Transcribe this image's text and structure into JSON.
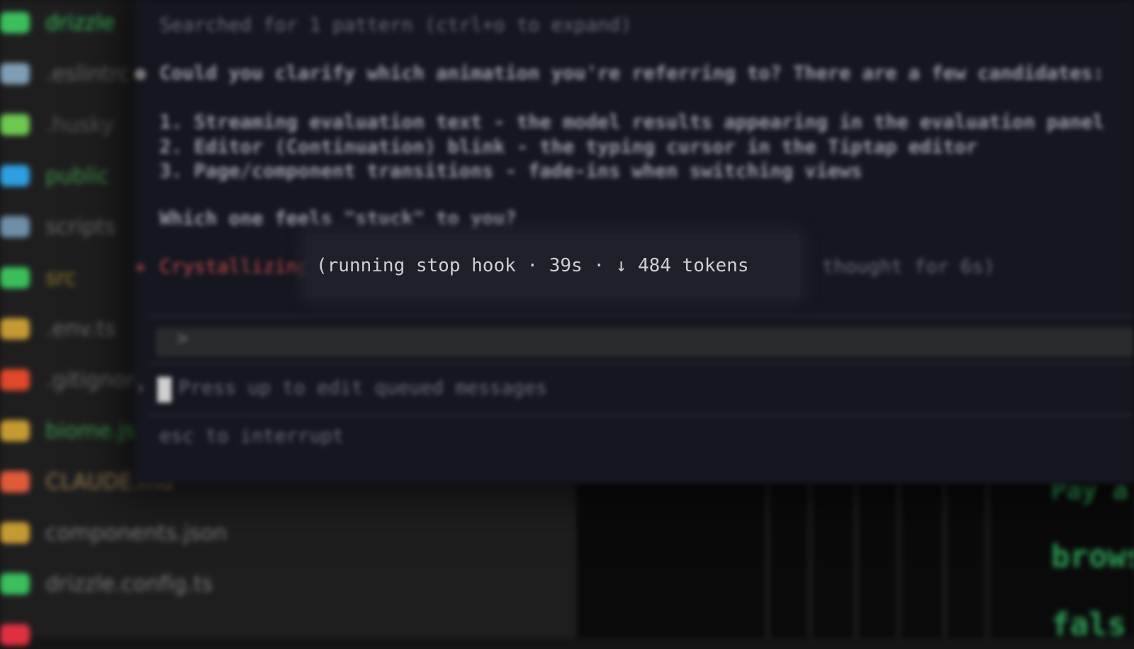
{
  "explorer": {
    "files": [
      {
        "name": "drizzle",
        "color": "#3bbf5a",
        "text_color": "#3bbf5a",
        "icon": "folder-icon"
      },
      {
        "name": ".eslintrc",
        "color": "#7f9db5",
        "text_color": "#6a6a6a",
        "icon": "file-icon"
      },
      {
        "name": ".husky",
        "color": "#6ec850",
        "text_color": "#555",
        "icon": "folder-icon"
      },
      {
        "name": "public",
        "color": "#2e9fe0",
        "text_color": "#3a9a45",
        "icon": "folder-icon"
      },
      {
        "name": "scripts",
        "color": "#6f8fa8",
        "text_color": "#6a6a6a",
        "icon": "folder-icon"
      },
      {
        "name": "src",
        "color": "#3bbf5a",
        "text_color": "#8f7a2a",
        "icon": "folder-icon"
      },
      {
        "name": ".env.ts",
        "color": "#c59a32",
        "text_color": "#6a6a6a",
        "icon": "file-icon"
      },
      {
        "name": ".gitignore",
        "color": "#e0482b",
        "text_color": "#6a6a6a",
        "icon": "file-icon"
      },
      {
        "name": "biome.json",
        "color": "#c59a32",
        "text_color": "#3a9a45",
        "icon": "file-icon"
      },
      {
        "name": "CLAUDE.md",
        "color": "#e05a3a",
        "text_color": "#9a7a4a",
        "icon": "file-icon"
      },
      {
        "name": "components.json",
        "color": "#c59a32",
        "text_color": "#7a7a7a",
        "icon": "file-icon"
      },
      {
        "name": "drizzle.config.ts",
        "color": "#3bbf5a",
        "text_color": "#7a7a7a",
        "icon": "file-icon"
      },
      {
        "name": "",
        "color": "#e03040",
        "text_color": "#7a7a7a",
        "icon": "file-icon"
      }
    ]
  },
  "terminal": {
    "line1": "Searched for 1 pattern (ctrl+o to expand)",
    "question": "Could you clarify which animation you're referring to? There are a few candidates:",
    "options": [
      "1. Streaming evaluation text - the model results appearing in the evaluation panel",
      "2. Editor (Continuation) blink - the typing cursor in the Tiptap editor",
      "3. Page/component transitions - fade-ins when switching views"
    ],
    "followup": "Which one feels \"stuck\" to you?",
    "spinner_word": "Crystallizing…",
    "thought": "thought for 6s)",
    "input_prompt": ">",
    "queued_hint": "Press up to edit queued messages",
    "interrupt_hint": "esc to interrupt"
  },
  "status": {
    "text": "(running stop hook · 39s · ↓ 484 tokens"
  },
  "bg_editor": {
    "lines": [
      "Pay a",
      "brows",
      "fals"
    ]
  }
}
